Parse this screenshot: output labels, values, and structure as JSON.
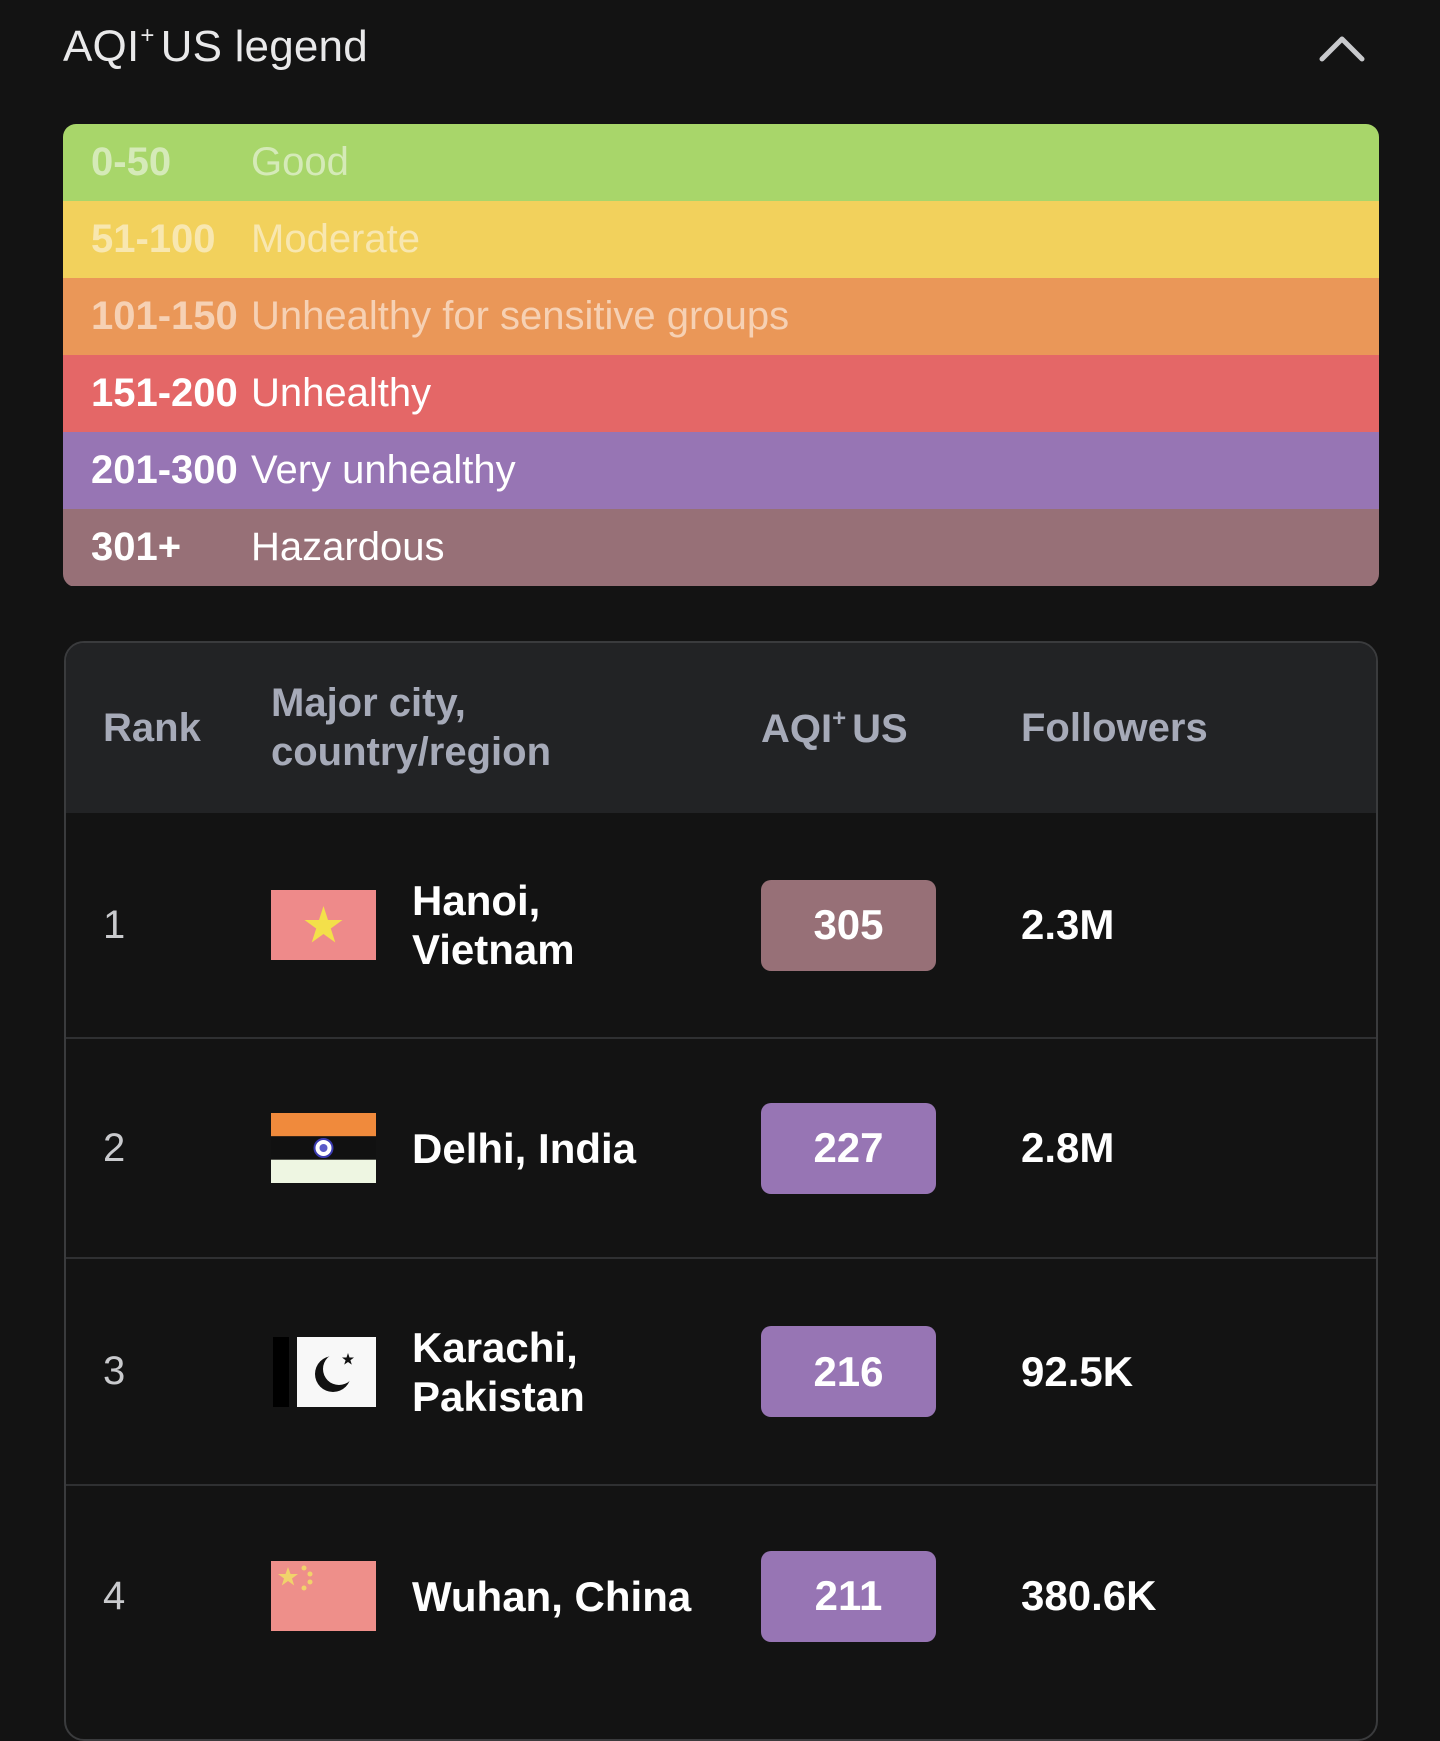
{
  "legend": {
    "title_main": "AQI",
    "title_sup": "+",
    "title_rest": "US legend",
    "collapse_icon": "chevron-up-icon",
    "rows": [
      {
        "range": "0-50",
        "label": "Good",
        "bg": "#a8d66a",
        "fg": "#d5eab8"
      },
      {
        "range": "51-100",
        "label": "Moderate",
        "bg": "#f2d15c",
        "fg": "#f8e7b0"
      },
      {
        "range": "101-150",
        "label": "Unhealthy for sensitive groups",
        "bg": "#ea9758",
        "fg": "#f6d1b4"
      },
      {
        "range": "151-200",
        "label": "Unhealthy",
        "bg": "#e46767",
        "fg": "#ffffff"
      },
      {
        "range": "201-300",
        "label": "Very unhealthy",
        "bg": "#9775b4",
        "fg": "#ffffff"
      },
      {
        "range": "301+",
        "label": "Hazardous",
        "bg": "#977077",
        "fg": "#ffffff"
      }
    ]
  },
  "ranking": {
    "headers": {
      "rank": "Rank",
      "city_line1": "Major city,",
      "city_line2": "country/region",
      "aqi_main": "AQI",
      "aqi_sup": "+",
      "aqi_rest": "US",
      "followers": "Followers"
    },
    "rows": [
      {
        "rank": "1",
        "city_line1": "Hanoi,",
        "city_line2": "Vietnam",
        "aqi": "305",
        "aqi_color": "#977077",
        "followers": "2.3M",
        "flag": "vietnam-flag-icon"
      },
      {
        "rank": "2",
        "city_line1": "Delhi, India",
        "city_line2": "",
        "aqi": "227",
        "aqi_color": "#9775b4",
        "followers": "2.8M",
        "flag": "india-flag-icon"
      },
      {
        "rank": "3",
        "city_line1": "Karachi,",
        "city_line2": "Pakistan",
        "aqi": "216",
        "aqi_color": "#9775b4",
        "followers": "92.5K",
        "flag": "pakistan-flag-icon"
      },
      {
        "rank": "4",
        "city_line1": "Wuhan, China",
        "city_line2": "",
        "aqi": "211",
        "aqi_color": "#9775b4",
        "followers": "380.6K",
        "flag": "china-flag-icon"
      }
    ]
  }
}
